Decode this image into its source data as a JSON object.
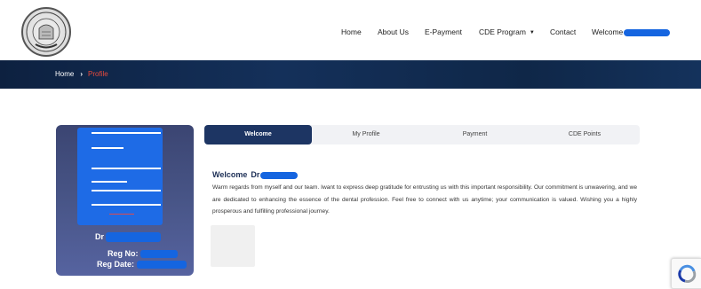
{
  "header": {
    "logo_icon": "association-seal-icon",
    "nav": {
      "home": "Home",
      "about": "About Us",
      "epayment": "E-Payment",
      "cde_program": "CDE Program",
      "contact": "Contact",
      "welcome": "Welcome"
    }
  },
  "breadcrumb": {
    "home": "Home",
    "separator": "›",
    "current": "Profile"
  },
  "profile_card": {
    "name_prefix": "Dr",
    "reg_no_label": "Reg No:",
    "reg_date_label": "Reg Date:"
  },
  "tabs": [
    "Welcome",
    "My Profile",
    "Payment",
    "CDE Points"
  ],
  "welcome": {
    "heading": "Welcome",
    "name_prefix": "Dr",
    "message": "Warm regards from myself and our team. Iwant to express deep gratitude for entrusting us with this important responsibility. Our commitment is unwavering, and we are dedicated to enhancing the essence of the dental profession. Feel free to connect with us anytime; your communication is valued. Wishing you a highly prosperous and fulfilling professional journey."
  },
  "colors": {
    "banner": "#14305a",
    "active_tab": "#1d3563",
    "breadcrumb_active": "#e84a3c",
    "redaction": "#1565e0",
    "card": "#485587"
  }
}
